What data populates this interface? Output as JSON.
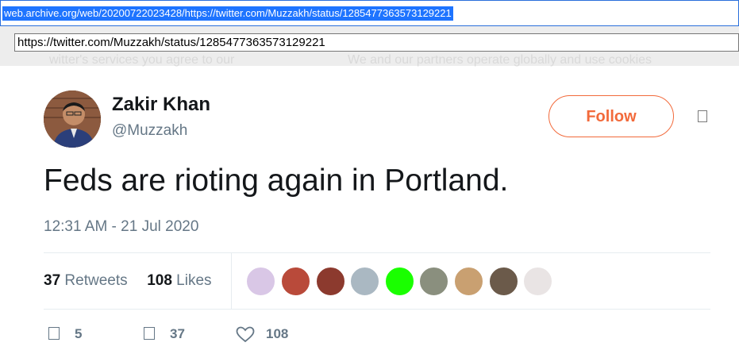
{
  "address_bar": {
    "selected_url": "web.archive.org/web/20200722023428/https://twitter.com/Muzzakh/status/1285477363573129221",
    "input_url": "https://twitter.com/Muzzakh/status/1285477363573129221"
  },
  "background_text": {
    "left": "witter's services you agree to our",
    "right": "We and our partners operate globally and use cookies"
  },
  "tweet": {
    "author_name": "Zakir Khan",
    "author_handle": "@Muzzakh",
    "follow_label": "Follow",
    "text": "Feds are rioting again in Portland.",
    "timestamp": "12:31 AM - 21 Jul 2020"
  },
  "stats": {
    "retweets_count": "37",
    "retweets_label": "Retweets",
    "likes_count": "108",
    "likes_label": "Likes"
  },
  "liker_avatars": [
    {
      "name": "liker-1",
      "color": "#d9c7e6"
    },
    {
      "name": "liker-2",
      "color": "#b94a3a"
    },
    {
      "name": "liker-3",
      "color": "#8c3a2e"
    },
    {
      "name": "liker-4",
      "color": "#aab8c2"
    },
    {
      "name": "liker-5",
      "color": "#1aff00"
    },
    {
      "name": "liker-6",
      "color": "#8a8f7e"
    },
    {
      "name": "liker-7",
      "color": "#c9a071"
    },
    {
      "name": "liker-8",
      "color": "#6b5a4a"
    },
    {
      "name": "liker-9",
      "color": "#e9e4e4"
    }
  ],
  "actions": {
    "reply_count": "5",
    "retweet_count": "37",
    "like_count": "108"
  },
  "colors": {
    "accent": "#f26a3b",
    "muted_text": "#657786",
    "selection": "#1e74ff"
  }
}
